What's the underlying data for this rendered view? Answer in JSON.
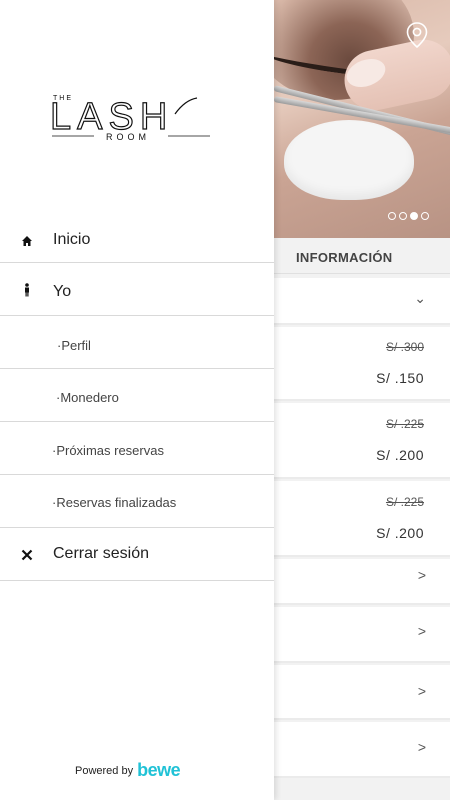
{
  "logo": {
    "line1": "THE",
    "line2": "LASH",
    "line3": "ROOM"
  },
  "menu": {
    "home_label": "Inicio",
    "me_label": "Yo",
    "sub_items": [
      {
        "label": "·Perfil"
      },
      {
        "label": "·Monedero"
      },
      {
        "label": "·Próximas reservas"
      },
      {
        "label": "·Reservas finalizadas"
      }
    ],
    "logout_label": "Cerrar sesión"
  },
  "powered": {
    "text": "Powered by",
    "brand": "bewe"
  },
  "background": {
    "section_title": "INFORMACIÓN",
    "carousel": {
      "total": 4,
      "active_index": 2
    },
    "chevron_down": "⌄",
    "chevron_right": ">",
    "prices": [
      {
        "old": "S/ .300",
        "new": "S/ .150"
      },
      {
        "old": "S/ .225",
        "new": "S/ .200"
      },
      {
        "old": "S/ .225",
        "new": "S/ .200"
      }
    ]
  },
  "colors": {
    "brand_accent": "#20c2d6",
    "divider": "#d9d9d9"
  }
}
